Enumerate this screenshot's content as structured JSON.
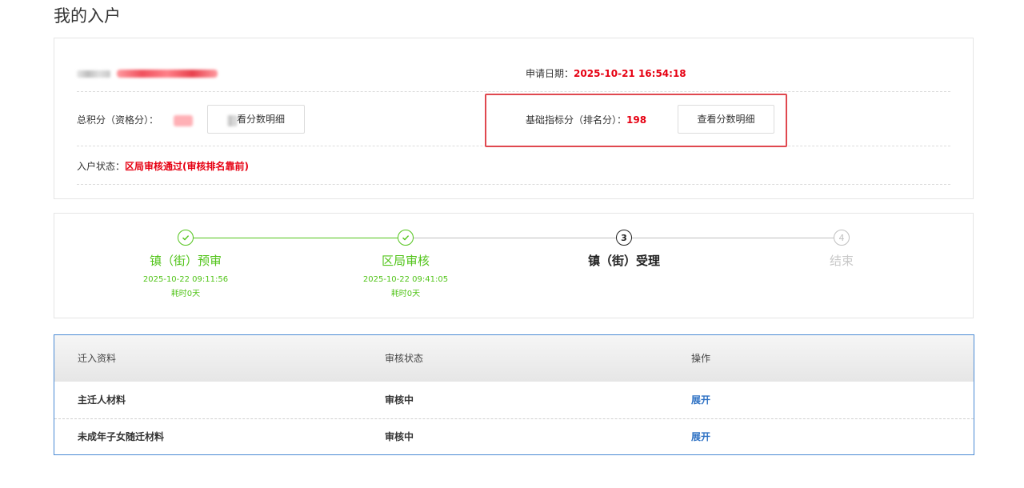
{
  "page": {
    "title": "我的入户"
  },
  "info": {
    "apply_date_label": "申请日期：",
    "apply_date_value": "2025-10-21 16:54:18",
    "total_score_label": "总积分（资格分）：",
    "total_detail_button": "看分数明细",
    "basic_score_label": "基础指标分（排名分）：",
    "basic_score_value": "198",
    "basic_detail_button": "查看分数明细",
    "status_label": "入户状态：",
    "status_value": "区局审核通过(审核排名靠前)"
  },
  "steps": [
    {
      "index": "1",
      "label": "镇（街）预审",
      "date": "2025-10-22 09:11:56",
      "duration": "耗时0天",
      "state": "done"
    },
    {
      "index": "2",
      "label": "区局审核",
      "date": "2025-10-22 09:41:05",
      "duration": "耗时0天",
      "state": "done"
    },
    {
      "index": "3",
      "label": "镇（街）受理",
      "state": "current"
    },
    {
      "index": "4",
      "label": "结束",
      "state": "pending"
    }
  ],
  "table": {
    "headers": [
      "迁入资料",
      "审核状态",
      "操作"
    ],
    "rows": [
      {
        "material": "主迁人材料",
        "status": "审核中",
        "action": "展开"
      },
      {
        "material": "未成年子女随迁材料",
        "status": "审核中",
        "action": "展开"
      }
    ]
  },
  "colors": {
    "accent_red": "#e60012",
    "done_green": "#52c41a",
    "link_blue": "#2f72c4",
    "highlight_red": "#e0484f"
  }
}
